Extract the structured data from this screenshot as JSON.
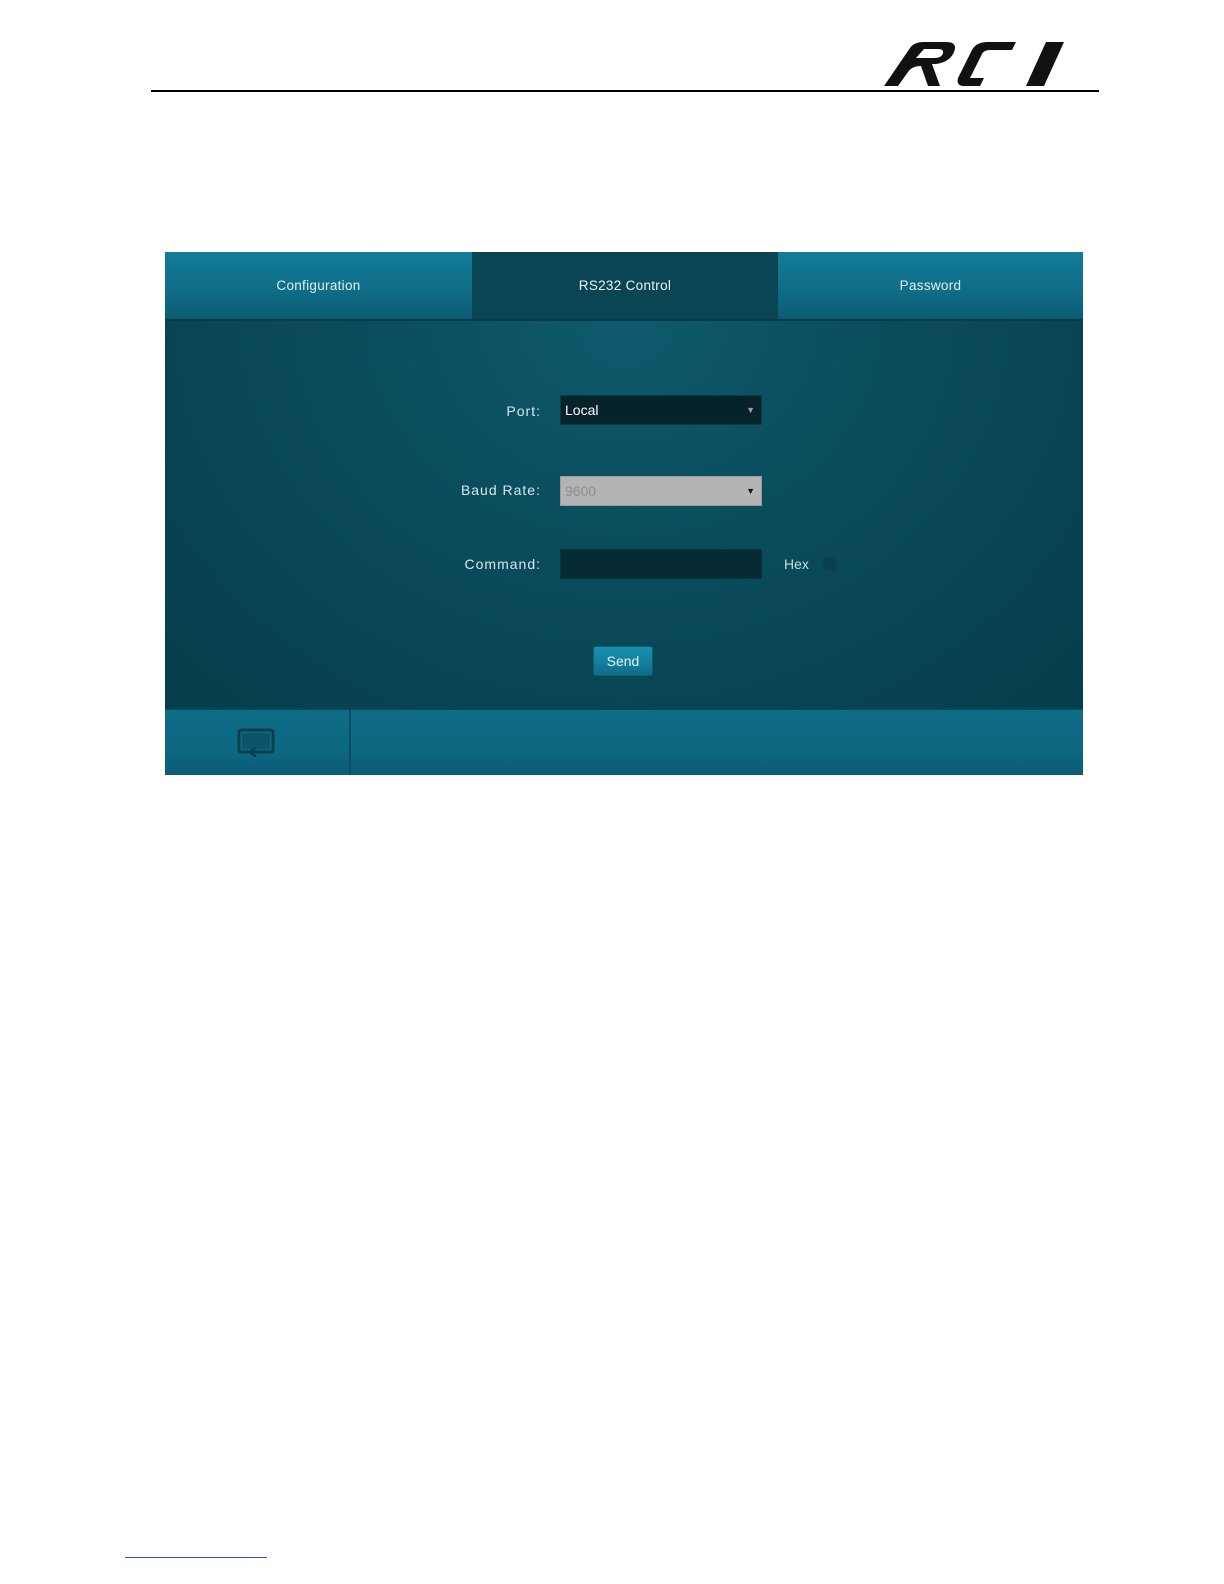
{
  "document": {
    "logo_text": "RTI"
  },
  "tabs": [
    {
      "label": "Configuration",
      "active": false
    },
    {
      "label": "RS232 Control",
      "active": true
    },
    {
      "label": "Password",
      "active": false
    }
  ],
  "form": {
    "port_label": "Port:",
    "port_value": "Local",
    "baud_label": "Baud Rate:",
    "baud_value": "9600",
    "command_label": "Command:",
    "command_value": "",
    "hex_label": "Hex",
    "hex_checked": false,
    "send_label": "Send"
  },
  "footer": {
    "logout_icon": "logout-icon"
  },
  "colors": {
    "panel_dark": "#0a4553",
    "tab_teal": "#0f6e88",
    "button_teal": "#1580a0"
  }
}
